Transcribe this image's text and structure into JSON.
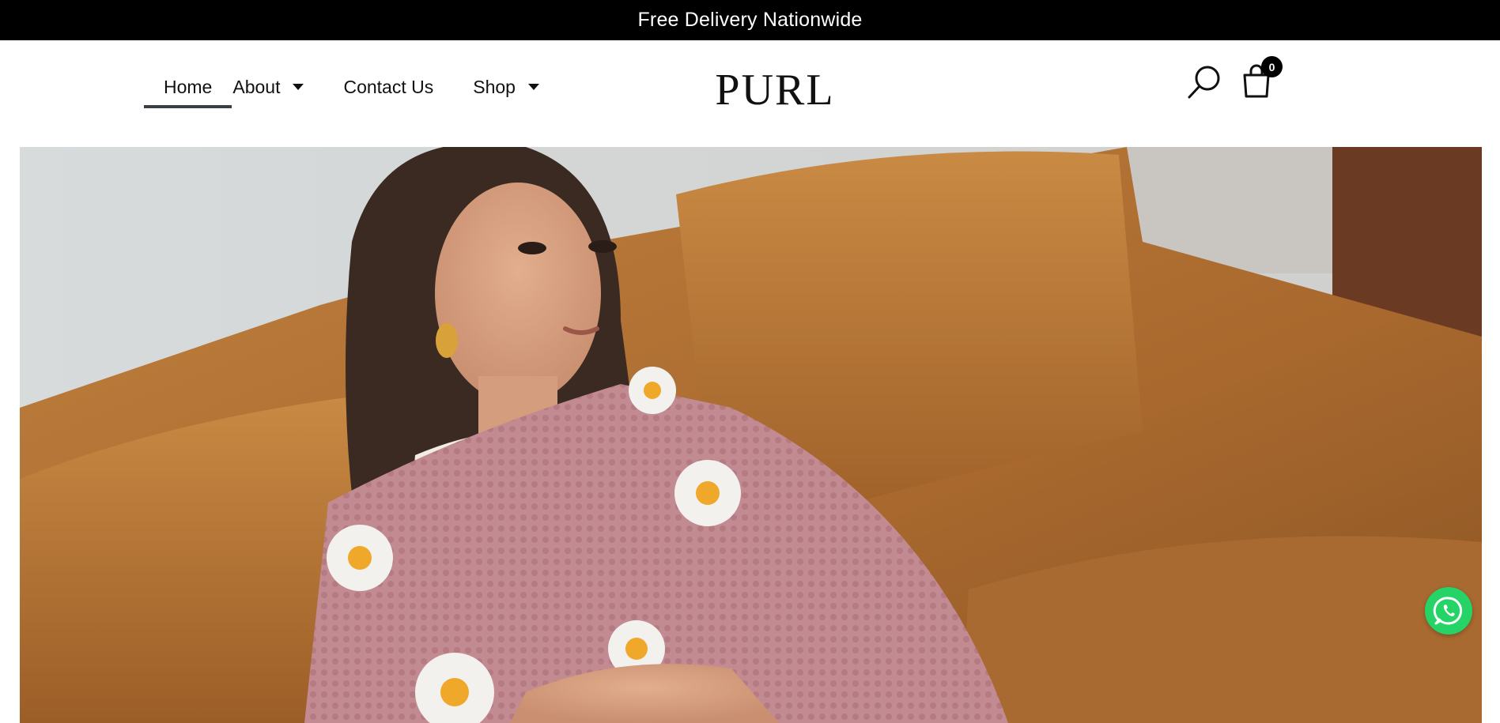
{
  "announcement": {
    "text": "Free Delivery Nationwide"
  },
  "nav": {
    "home": "Home",
    "about": "About",
    "contact": "Contact Us",
    "shop": "Shop"
  },
  "brand": {
    "logo_text": "PURL"
  },
  "cart": {
    "count": "0"
  },
  "icons": {
    "search": "search-icon",
    "cart": "shopping-bag-icon",
    "dropdown": "caret-down-icon",
    "chat": "whatsapp-icon"
  },
  "colors": {
    "announcement_bg": "#000000",
    "active_underline": "#3a3f45",
    "whatsapp_green": "#25d366",
    "sofa": "#b07335",
    "cardigan": "#c28a91",
    "wall": "#d9dcdd"
  }
}
